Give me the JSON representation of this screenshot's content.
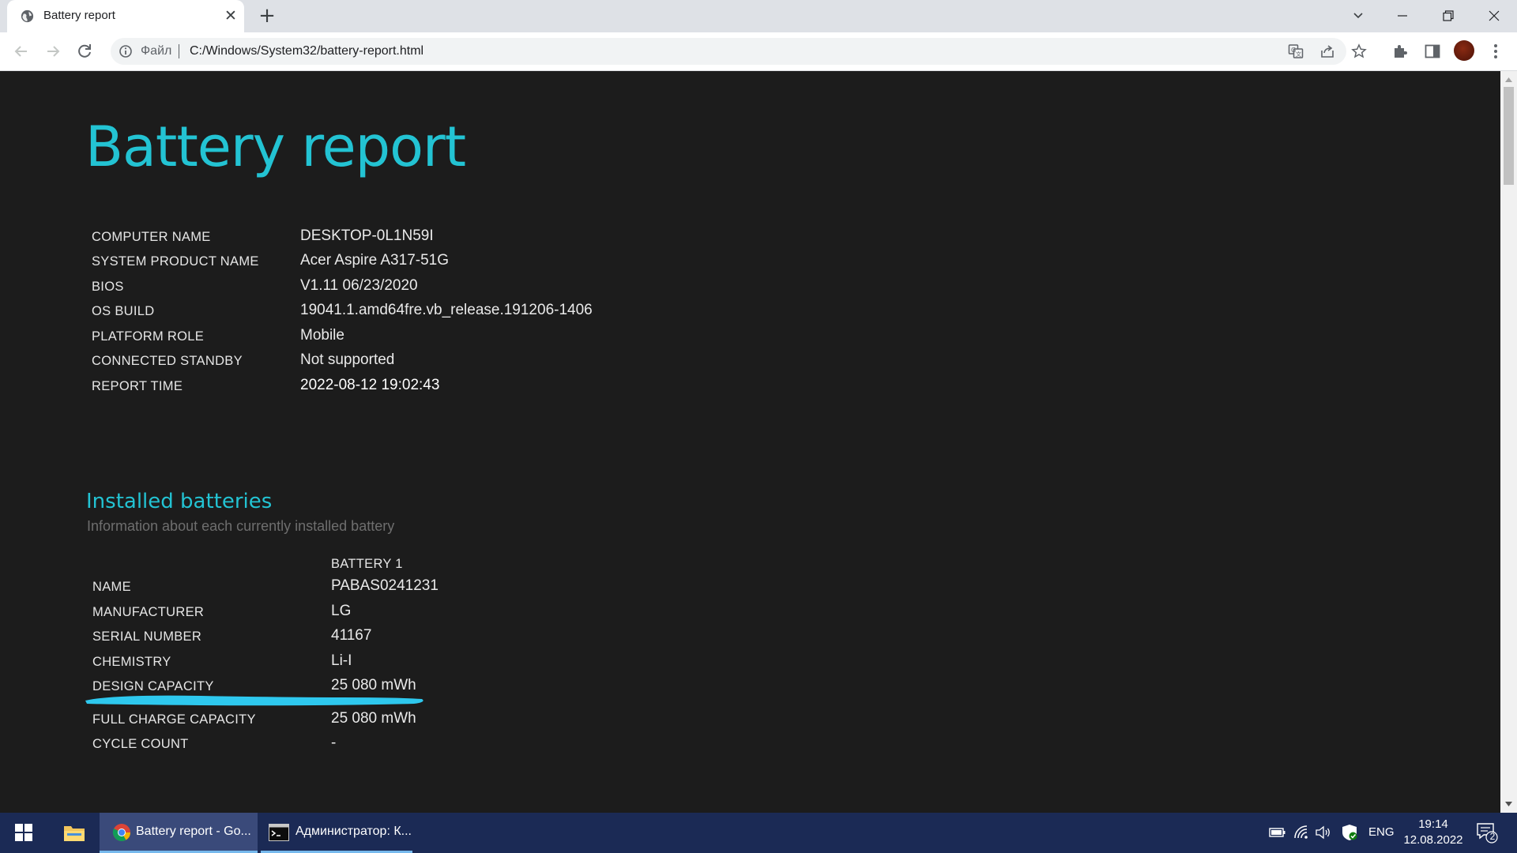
{
  "browser": {
    "tab_title": "Battery report",
    "tab_close": "✕",
    "new_tab": "+",
    "omnibox_scheme": "Файл",
    "omnibox_url": "C:/Windows/System32/battery-report.html",
    "window_controls": {
      "tabsearch": "⌄",
      "minimize": "—",
      "restore": "❐",
      "close": "✕"
    }
  },
  "report": {
    "title": "Battery report",
    "system_info": [
      {
        "label": "COMPUTER NAME",
        "value": "DESKTOP-0L1N59I"
      },
      {
        "label": "SYSTEM PRODUCT NAME",
        "value": "Acer Aspire A317-51G"
      },
      {
        "label": "BIOS",
        "value": "V1.11 06/23/2020"
      },
      {
        "label": "OS BUILD",
        "value": "19041.1.amd64fre.vb_release.191206-1406"
      },
      {
        "label": "PLATFORM ROLE",
        "value": "Mobile"
      },
      {
        "label": "CONNECTED STANDBY",
        "value": "Not supported"
      },
      {
        "label": "REPORT TIME",
        "value": "2022-08-12  19:02:43"
      }
    ],
    "installed_batteries": {
      "title": "Installed batteries",
      "subtitle": "Information about each currently installed battery",
      "column_header": "BATTERY 1",
      "rows": [
        {
          "label": "NAME",
          "value": "PABAS0241231"
        },
        {
          "label": "MANUFACTURER",
          "value": "LG"
        },
        {
          "label": "SERIAL NUMBER",
          "value": "41167"
        },
        {
          "label": "CHEMISTRY",
          "value": "Li-I"
        },
        {
          "label": "DESIGN CAPACITY",
          "value": "25 080 mWh"
        },
        {
          "label": "FULL CHARGE CAPACITY",
          "value": "25 080 mWh"
        },
        {
          "label": "CYCLE COUNT",
          "value": "-"
        }
      ]
    }
  },
  "taskbar": {
    "apps": [
      {
        "label": "Battery report - Go..."
      },
      {
        "label": "Администратор: К..."
      }
    ],
    "language": "ENG",
    "time": "19:14",
    "date": "12.08.2022",
    "notification_count": "2"
  },
  "colors": {
    "accent": "#23c3d3",
    "page_background": "#1c1c1c",
    "highlight_stroke": "#2ec8ee",
    "taskbar": "#1b2a55"
  }
}
